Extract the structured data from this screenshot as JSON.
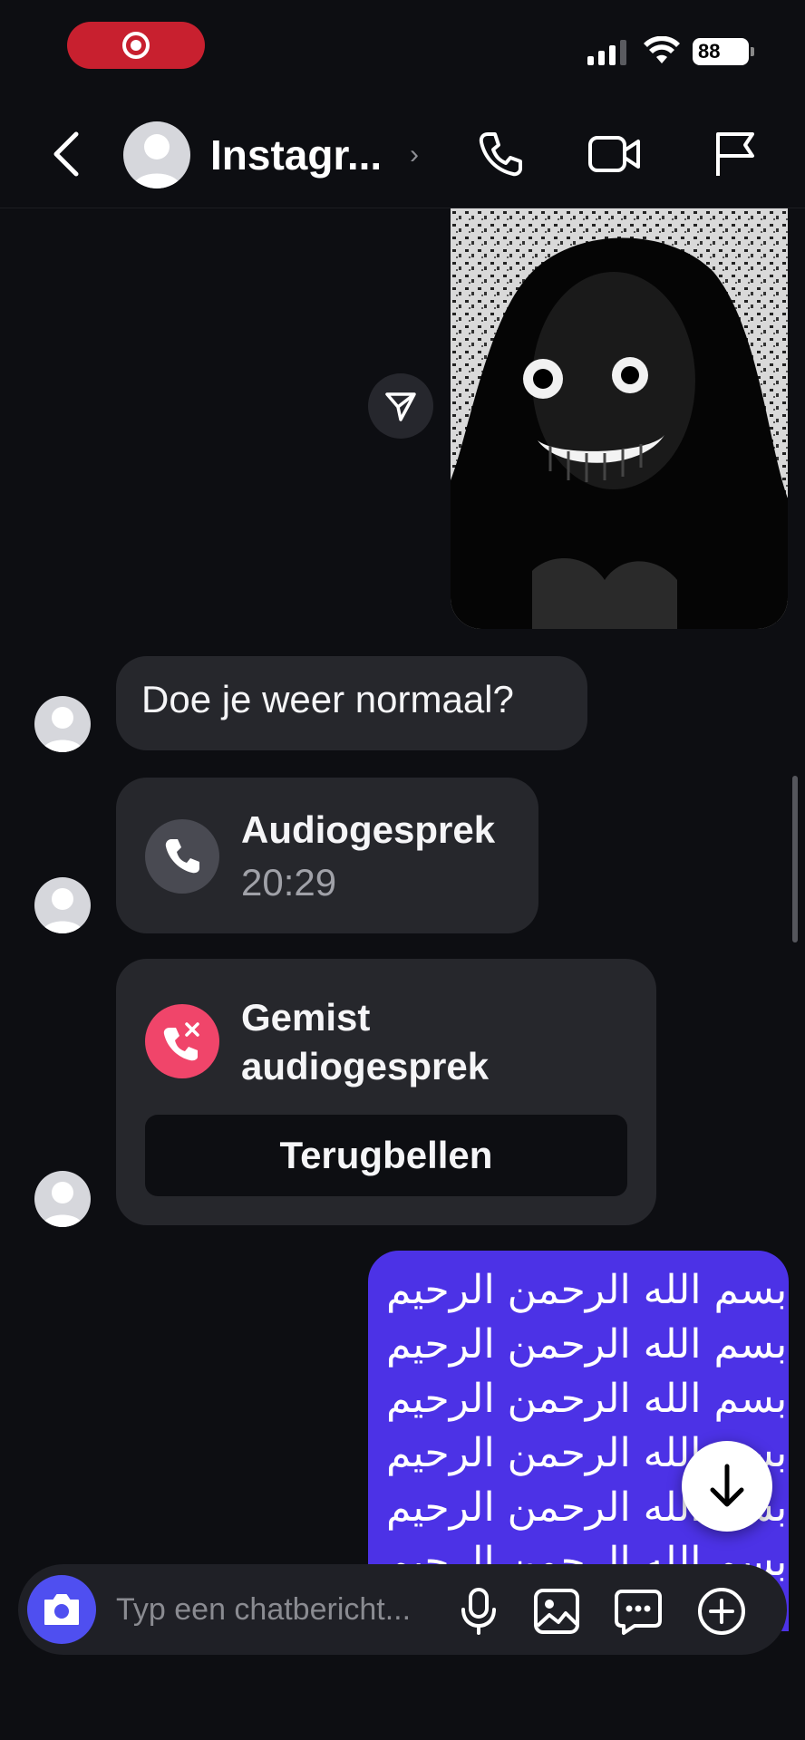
{
  "status_bar": {
    "battery": "88"
  },
  "header": {
    "title": "Instagr...",
    "chevron": "›"
  },
  "messages": {
    "text_message": "Doe je weer normaal?",
    "audio_call": {
      "title": "Audiogesprek",
      "time": "20:29"
    },
    "missed_call": {
      "title": "Gemist audiogesprek",
      "button": "Terugbellen"
    },
    "calligraphy_image": {
      "text": "بسم الله الرحمن الرحيم"
    }
  },
  "composer": {
    "placeholder": "Typ een chatbericht..."
  },
  "colors": {
    "background": "#0d0e12",
    "bubble": "#26272c",
    "record_red": "#c8202f",
    "missed_pink": "#f0456a",
    "camera_blue": "#4f4ff0",
    "image_purple": "#4c32e6"
  },
  "icons": [
    "record-icon",
    "signal-icon",
    "wifi-icon",
    "battery-icon",
    "back-icon",
    "phone-icon",
    "video-icon",
    "flag-icon",
    "share-icon",
    "call-icon",
    "missed-call-icon",
    "arrow-down-icon",
    "camera-icon",
    "microphone-icon",
    "gallery-icon",
    "sticker-icon",
    "plus-icon"
  ]
}
